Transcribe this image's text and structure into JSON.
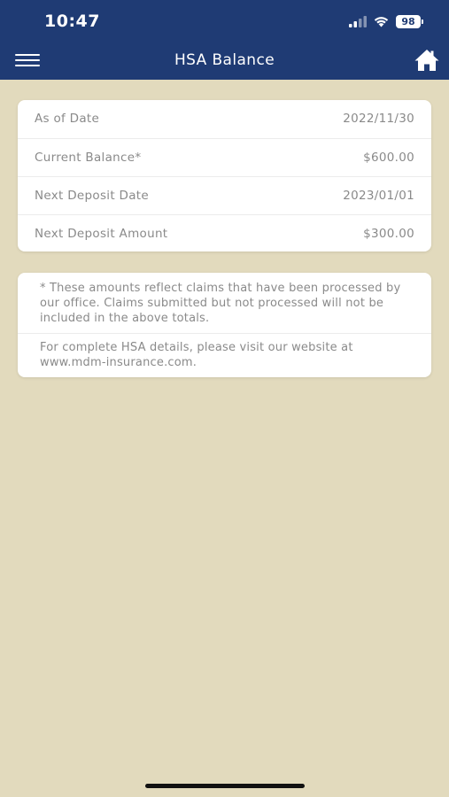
{
  "status_bar": {
    "time": "10:47",
    "battery": "98",
    "icons": [
      "signal-icon",
      "wifi-icon",
      "battery-icon"
    ]
  },
  "header": {
    "title": "HSA Balance",
    "menu_icon": "hamburger-menu-icon",
    "home_icon": "home-icon",
    "color": "#1f3b74"
  },
  "balance": {
    "rows": [
      {
        "label": "As of Date",
        "value": "2022/11/30"
      },
      {
        "label": "Current Balance*",
        "value": "$600.00"
      },
      {
        "label": "Next Deposit Date",
        "value": "2023/01/01"
      },
      {
        "label": "Next Deposit Amount",
        "value": "$300.00"
      }
    ]
  },
  "notes": {
    "disclaimer": "* These amounts reflect claims that have been processed by our office. Claims submitted but not processed will not be included in the above totals.",
    "website": "For complete HSA details, please visit our website at www.mdm-insurance.com."
  },
  "colors": {
    "background": "#e2dabd",
    "card": "#ffffff",
    "text": "#8a8a8a"
  }
}
